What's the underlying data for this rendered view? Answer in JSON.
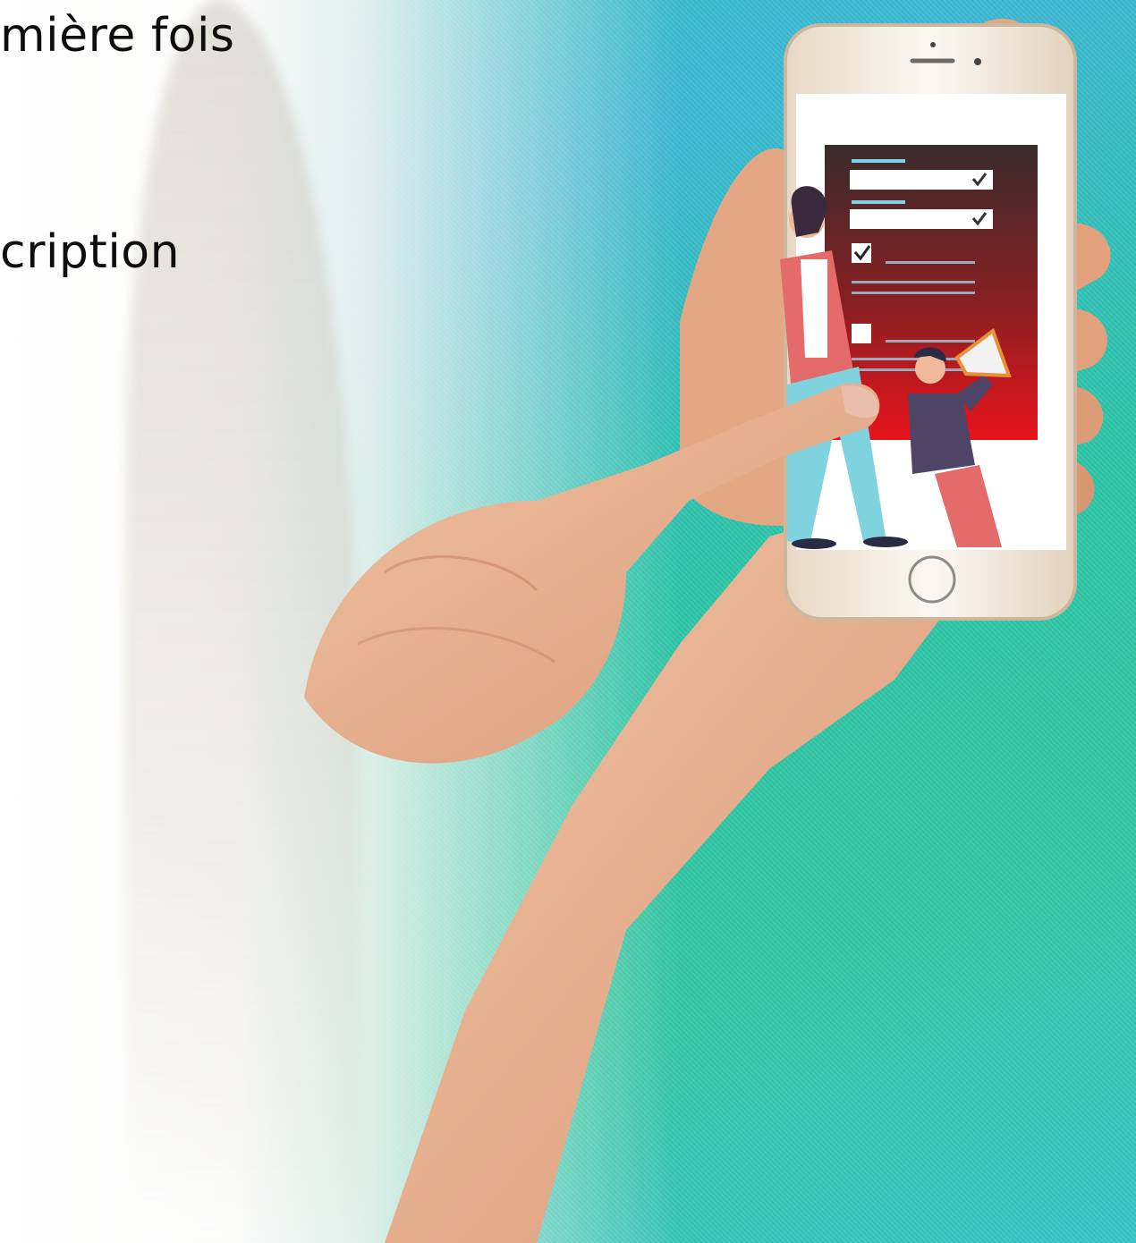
{
  "headline": {
    "line1": "mière fois",
    "line2": "cription"
  },
  "colors": {
    "background_teal": "#2fc6c0",
    "form_gradient_top": "#3a2b2c",
    "form_gradient_bottom": "#e8141c",
    "skin": "#e9b08f",
    "phone_body": "#f4efe8"
  },
  "icons": [
    "checkbox-checked-icon",
    "megaphone-icon",
    "home-button-icon",
    "camera-icon"
  ]
}
